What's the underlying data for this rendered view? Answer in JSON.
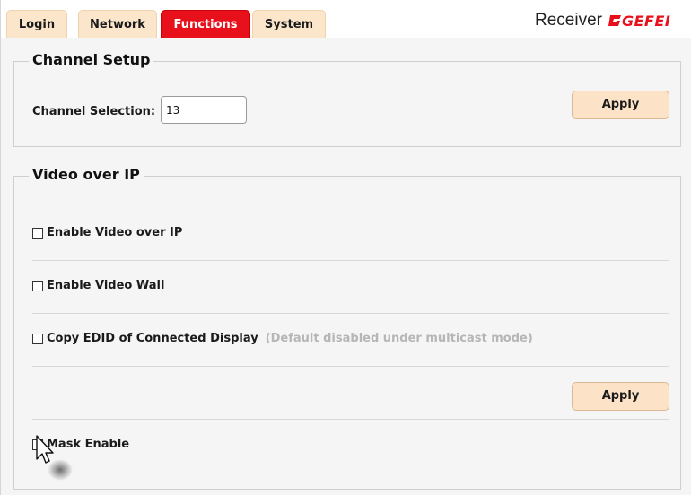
{
  "tabs": [
    {
      "label": "Login",
      "active": false
    },
    {
      "label": "Network",
      "active": false
    },
    {
      "label": "Functions",
      "active": true
    },
    {
      "label": "System",
      "active": false
    }
  ],
  "brand": {
    "title": "Receiver",
    "logo_text": "GEFEI",
    "accent_color": "#e8101a"
  },
  "channel_setup": {
    "legend": "Channel Setup",
    "channel_label": "Channel Selection:",
    "channel_value": "13",
    "apply_label": "Apply"
  },
  "video_over_ip": {
    "legend": "Video over IP",
    "options": [
      {
        "label": "Enable Video over IP",
        "checked": false,
        "note": ""
      },
      {
        "label": "Enable Video Wall",
        "checked": false,
        "note": ""
      },
      {
        "label": "Copy EDID of Connected Display",
        "checked": false,
        "note": "(Default disabled under multicast mode)"
      }
    ],
    "apply_label": "Apply",
    "mask": {
      "label": "Mask Enable",
      "checked": false
    }
  },
  "colors": {
    "tab_active": "#e8101a",
    "tab_inactive": "#fbe6cc",
    "button": "#fce2c7",
    "note_text": "#b6b6b6"
  },
  "icons": {
    "logo": "gefen-g-logo-icon",
    "cursor": "mouse-pointer-icon"
  }
}
